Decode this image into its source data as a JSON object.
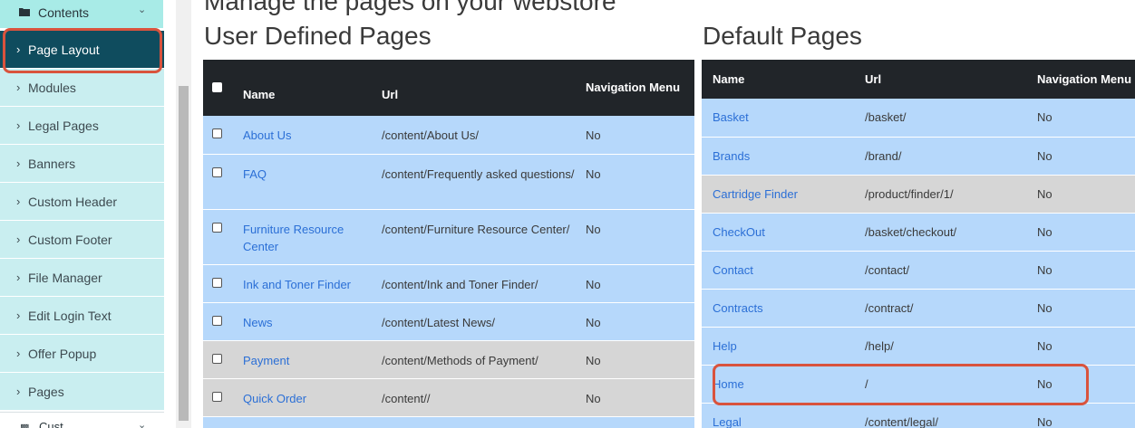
{
  "sidebar": {
    "group_label": "Contents",
    "items": [
      {
        "label": "Page Layout",
        "active": true
      },
      {
        "label": "Modules"
      },
      {
        "label": "Legal Pages"
      },
      {
        "label": "Banners"
      },
      {
        "label": "Custom Header"
      },
      {
        "label": "Custom Footer"
      },
      {
        "label": "File Manager"
      },
      {
        "label": "Edit Login Text"
      },
      {
        "label": "Offer Popup"
      },
      {
        "label": "Pages"
      }
    ],
    "bottom_label": "Cust"
  },
  "main": {
    "heading": "Manage the pages on your webstore",
    "user_pages": {
      "title": "User Defined Pages",
      "columns": [
        "Name",
        "Url",
        "Navigation Menu"
      ],
      "rows": [
        {
          "name": "About Us",
          "url": "/content/About Us/",
          "nav": "No"
        },
        {
          "name": "FAQ",
          "url": "/content/Frequently asked questions/",
          "nav": "No"
        },
        {
          "name": "Furniture Resource Center",
          "url": "/content/Furniture Resource Center/",
          "nav": "No"
        },
        {
          "name": "Ink and Toner Finder",
          "url": "/content/Ink and Toner Finder/",
          "nav": "No"
        },
        {
          "name": "News",
          "url": "/content/Latest News/",
          "nav": "No"
        },
        {
          "name": "Payment",
          "url": "/content/Methods of Payment/",
          "nav": "No"
        },
        {
          "name": "Quick Order",
          "url": "/content//",
          "nav": "No"
        }
      ]
    },
    "default_pages": {
      "title": "Default Pages",
      "columns": [
        "Name",
        "Url",
        "Navigation Menu"
      ],
      "rows": [
        {
          "name": "Basket",
          "url": "/basket/",
          "nav": "No"
        },
        {
          "name": "Brands",
          "url": "/brand/",
          "nav": "No"
        },
        {
          "name": "Cartridge Finder",
          "url": "/product/finder/1/",
          "nav": "No"
        },
        {
          "name": "CheckOut",
          "url": "/basket/checkout/",
          "nav": "No"
        },
        {
          "name": "Contact",
          "url": "/contact/",
          "nav": "No"
        },
        {
          "name": "Contracts",
          "url": "/contract/",
          "nav": "No"
        },
        {
          "name": "Help",
          "url": "/help/",
          "nav": "No"
        },
        {
          "name": "Home",
          "url": "/",
          "nav": "No"
        },
        {
          "name": "Legal",
          "url": "/content/legal/",
          "nav": "No"
        }
      ]
    }
  },
  "colors": {
    "accent": "#0f4c5e",
    "highlight": "#d9533d",
    "row_blue": "#b6d8fb",
    "row_grey": "#d6d6d6",
    "header_dark": "#212529"
  }
}
